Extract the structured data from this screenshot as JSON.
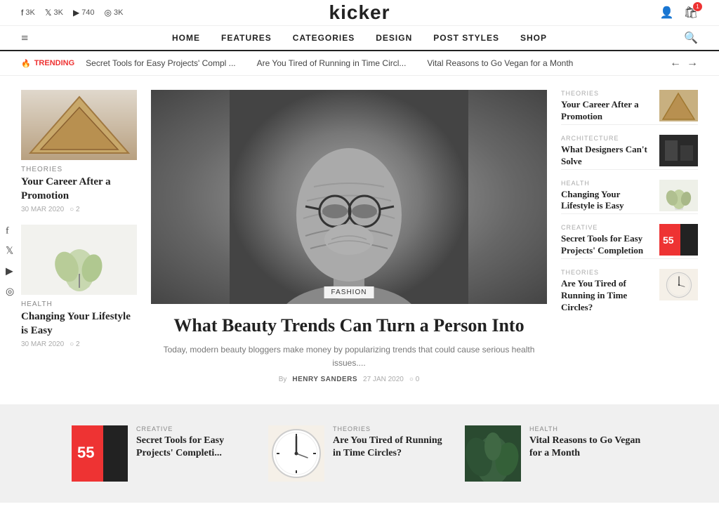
{
  "site": {
    "title": "kicker"
  },
  "topbar": {
    "socials": [
      {
        "icon": "f",
        "label": "3K",
        "id": "facebook"
      },
      {
        "icon": "𝕏",
        "label": "3K",
        "id": "twitter"
      },
      {
        "icon": "▶",
        "label": "740",
        "id": "youtube"
      },
      {
        "icon": "◎",
        "label": "3K",
        "id": "instagram"
      }
    ],
    "cart_count": "1"
  },
  "nav": {
    "hamburger": "≡",
    "links": [
      "HOME",
      "FEATURES",
      "CATEGORIES",
      "DESIGN",
      "POST STYLES",
      "SHOP"
    ],
    "search_icon": "🔍"
  },
  "trending": {
    "label": "TRENDING",
    "items": [
      "Secret Tools for Easy Projects' Compl ...",
      "Are You Tired of Running in Time Circl...",
      "Vital Reasons to Go Vegan for a Month"
    ]
  },
  "left_articles": [
    {
      "category": "THEORIES",
      "title": "Your Career After a Promotion",
      "date": "30 MAR 2020",
      "comments": "2",
      "img_type": "architecture"
    },
    {
      "category": "HEALTH",
      "title": "Changing Your Lifestyle is Easy",
      "date": "30 MAR 2020",
      "comments": "2",
      "img_type": "plant"
    }
  ],
  "hero": {
    "category": "FASHION",
    "title": "What Beauty Trends Can Turn a Person Into",
    "excerpt": "Today, modern beauty bloggers make money by popularizing trends that could cause serious health issues....",
    "author": "HENRY SANDERS",
    "date": "27 JAN 2020",
    "comments": "0"
  },
  "right_articles": [
    {
      "category": "THEORIES",
      "title": "Your Career After a Promotion",
      "img_type": "architecture"
    },
    {
      "category": "ARCHITECTURE",
      "title": "What Designers Can't Solve",
      "img_type": "dark"
    },
    {
      "category": "HEALTH",
      "title": "Changing Your Lifestyle is Easy",
      "img_type": "plant"
    },
    {
      "category": "CREATIVE",
      "title": "Secret Tools for Easy Projects' Completion",
      "img_type": "red"
    },
    {
      "category": "THEORIES",
      "title": "Are You Tired of Running in Time Circles?",
      "img_type": "clock"
    }
  ],
  "bottom_articles": [
    {
      "category": "CREATIVE",
      "title": "Secret Tools for Easy Projects' Completi...",
      "img_type": "red"
    },
    {
      "category": "THEORIES",
      "title": "Are You Tired of Running in Time Circles?",
      "img_type": "clock"
    },
    {
      "category": "HEALTH",
      "title": "Vital Reasons to Go Vegan for a Month",
      "img_type": "green"
    }
  ],
  "float_social": {
    "icons": [
      "f",
      "𝕏",
      "▶",
      "◎"
    ]
  },
  "by_label": "By",
  "comments_icon": "○"
}
